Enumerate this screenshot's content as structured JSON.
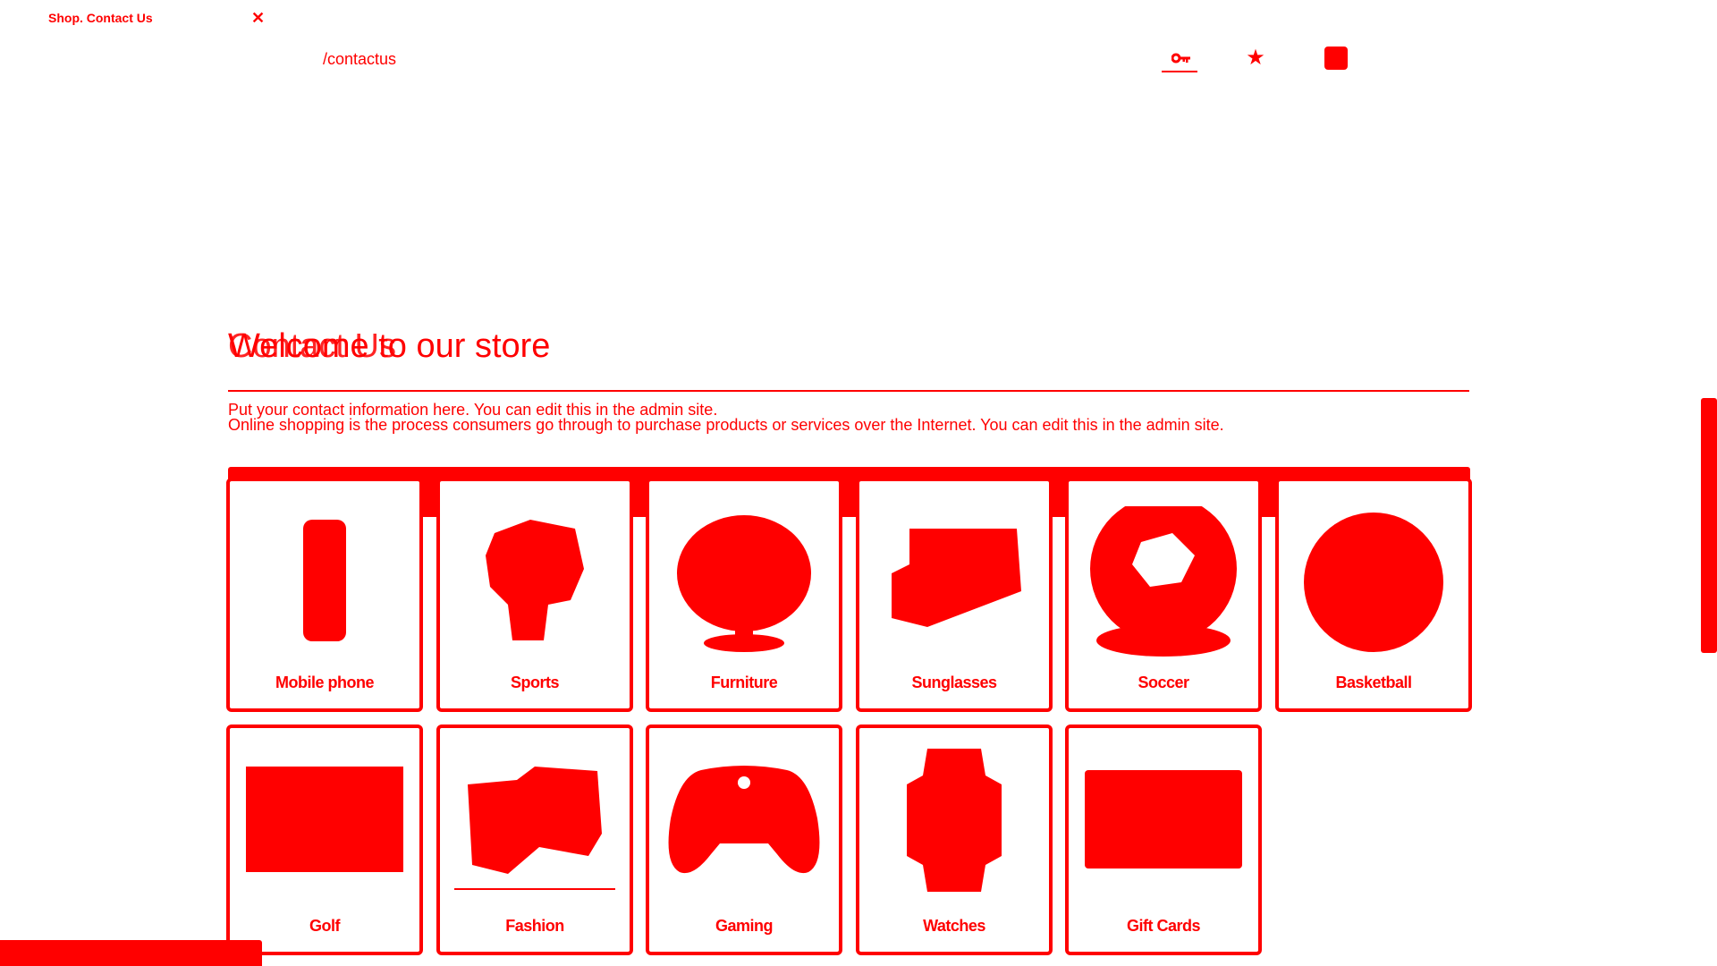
{
  "tab": {
    "title": "Shop. Contact Us",
    "close_icon": "close-icon"
  },
  "address_bar": {
    "url": "/contactus"
  },
  "toolbar": {
    "icons": [
      "key-icon",
      "star-icon",
      "extension-icon"
    ]
  },
  "page": {
    "heading_contact": "Contact Us",
    "heading_welcome": "Welcome to our store",
    "contact_text": "Put your contact information here. You can edit this in the admin site.",
    "welcome_text": "Online shopping is the process consumers go through to purchase products or services over the Internet. You can edit this in the admin site."
  },
  "categories": [
    {
      "label": "Mobile phone",
      "icon": "mobile-phone-icon"
    },
    {
      "label": "Sports",
      "icon": "sports-icon"
    },
    {
      "label": "Furniture",
      "icon": "furniture-icon"
    },
    {
      "label": "Sunglasses",
      "icon": "sunglasses-icon"
    },
    {
      "label": "Soccer",
      "icon": "soccer-ball-icon"
    },
    {
      "label": "Basketball",
      "icon": "basketball-icon"
    },
    {
      "label": "Golf",
      "icon": "golf-icon"
    },
    {
      "label": "Fashion",
      "icon": "fashion-icon"
    },
    {
      "label": "Gaming",
      "icon": "game-controller-icon"
    },
    {
      "label": "Watches",
      "icon": "watch-icon"
    },
    {
      "label": "Gift Cards",
      "icon": "gift-card-icon"
    }
  ],
  "colors": {
    "accent": "#ff0000",
    "background": "#ffffff"
  }
}
